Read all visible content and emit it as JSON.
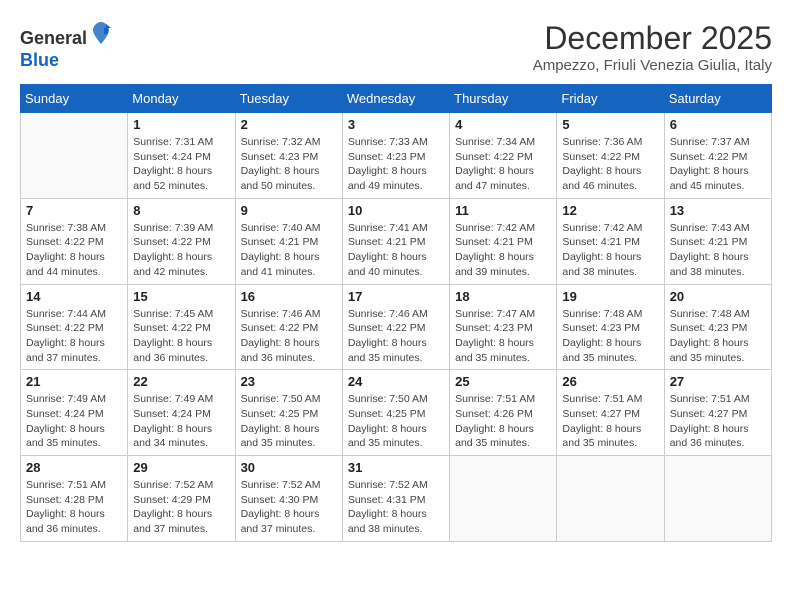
{
  "logo": {
    "general": "General",
    "blue": "Blue"
  },
  "title": "December 2025",
  "subtitle": "Ampezzo, Friuli Venezia Giulia, Italy",
  "days_of_week": [
    "Sunday",
    "Monday",
    "Tuesday",
    "Wednesday",
    "Thursday",
    "Friday",
    "Saturday"
  ],
  "weeks": [
    [
      {
        "day": "",
        "sunrise": "",
        "sunset": "",
        "daylight": ""
      },
      {
        "day": "1",
        "sunrise": "Sunrise: 7:31 AM",
        "sunset": "Sunset: 4:24 PM",
        "daylight": "Daylight: 8 hours and 52 minutes."
      },
      {
        "day": "2",
        "sunrise": "Sunrise: 7:32 AM",
        "sunset": "Sunset: 4:23 PM",
        "daylight": "Daylight: 8 hours and 50 minutes."
      },
      {
        "day": "3",
        "sunrise": "Sunrise: 7:33 AM",
        "sunset": "Sunset: 4:23 PM",
        "daylight": "Daylight: 8 hours and 49 minutes."
      },
      {
        "day": "4",
        "sunrise": "Sunrise: 7:34 AM",
        "sunset": "Sunset: 4:22 PM",
        "daylight": "Daylight: 8 hours and 47 minutes."
      },
      {
        "day": "5",
        "sunrise": "Sunrise: 7:36 AM",
        "sunset": "Sunset: 4:22 PM",
        "daylight": "Daylight: 8 hours and 46 minutes."
      },
      {
        "day": "6",
        "sunrise": "Sunrise: 7:37 AM",
        "sunset": "Sunset: 4:22 PM",
        "daylight": "Daylight: 8 hours and 45 minutes."
      }
    ],
    [
      {
        "day": "7",
        "sunrise": "Sunrise: 7:38 AM",
        "sunset": "Sunset: 4:22 PM",
        "daylight": "Daylight: 8 hours and 44 minutes."
      },
      {
        "day": "8",
        "sunrise": "Sunrise: 7:39 AM",
        "sunset": "Sunset: 4:22 PM",
        "daylight": "Daylight: 8 hours and 42 minutes."
      },
      {
        "day": "9",
        "sunrise": "Sunrise: 7:40 AM",
        "sunset": "Sunset: 4:21 PM",
        "daylight": "Daylight: 8 hours and 41 minutes."
      },
      {
        "day": "10",
        "sunrise": "Sunrise: 7:41 AM",
        "sunset": "Sunset: 4:21 PM",
        "daylight": "Daylight: 8 hours and 40 minutes."
      },
      {
        "day": "11",
        "sunrise": "Sunrise: 7:42 AM",
        "sunset": "Sunset: 4:21 PM",
        "daylight": "Daylight: 8 hours and 39 minutes."
      },
      {
        "day": "12",
        "sunrise": "Sunrise: 7:42 AM",
        "sunset": "Sunset: 4:21 PM",
        "daylight": "Daylight: 8 hours and 38 minutes."
      },
      {
        "day": "13",
        "sunrise": "Sunrise: 7:43 AM",
        "sunset": "Sunset: 4:21 PM",
        "daylight": "Daylight: 8 hours and 38 minutes."
      }
    ],
    [
      {
        "day": "14",
        "sunrise": "Sunrise: 7:44 AM",
        "sunset": "Sunset: 4:22 PM",
        "daylight": "Daylight: 8 hours and 37 minutes."
      },
      {
        "day": "15",
        "sunrise": "Sunrise: 7:45 AM",
        "sunset": "Sunset: 4:22 PM",
        "daylight": "Daylight: 8 hours and 36 minutes."
      },
      {
        "day": "16",
        "sunrise": "Sunrise: 7:46 AM",
        "sunset": "Sunset: 4:22 PM",
        "daylight": "Daylight: 8 hours and 36 minutes."
      },
      {
        "day": "17",
        "sunrise": "Sunrise: 7:46 AM",
        "sunset": "Sunset: 4:22 PM",
        "daylight": "Daylight: 8 hours and 35 minutes."
      },
      {
        "day": "18",
        "sunrise": "Sunrise: 7:47 AM",
        "sunset": "Sunset: 4:23 PM",
        "daylight": "Daylight: 8 hours and 35 minutes."
      },
      {
        "day": "19",
        "sunrise": "Sunrise: 7:48 AM",
        "sunset": "Sunset: 4:23 PM",
        "daylight": "Daylight: 8 hours and 35 minutes."
      },
      {
        "day": "20",
        "sunrise": "Sunrise: 7:48 AM",
        "sunset": "Sunset: 4:23 PM",
        "daylight": "Daylight: 8 hours and 35 minutes."
      }
    ],
    [
      {
        "day": "21",
        "sunrise": "Sunrise: 7:49 AM",
        "sunset": "Sunset: 4:24 PM",
        "daylight": "Daylight: 8 hours and 35 minutes."
      },
      {
        "day": "22",
        "sunrise": "Sunrise: 7:49 AM",
        "sunset": "Sunset: 4:24 PM",
        "daylight": "Daylight: 8 hours and 34 minutes."
      },
      {
        "day": "23",
        "sunrise": "Sunrise: 7:50 AM",
        "sunset": "Sunset: 4:25 PM",
        "daylight": "Daylight: 8 hours and 35 minutes."
      },
      {
        "day": "24",
        "sunrise": "Sunrise: 7:50 AM",
        "sunset": "Sunset: 4:25 PM",
        "daylight": "Daylight: 8 hours and 35 minutes."
      },
      {
        "day": "25",
        "sunrise": "Sunrise: 7:51 AM",
        "sunset": "Sunset: 4:26 PM",
        "daylight": "Daylight: 8 hours and 35 minutes."
      },
      {
        "day": "26",
        "sunrise": "Sunrise: 7:51 AM",
        "sunset": "Sunset: 4:27 PM",
        "daylight": "Daylight: 8 hours and 35 minutes."
      },
      {
        "day": "27",
        "sunrise": "Sunrise: 7:51 AM",
        "sunset": "Sunset: 4:27 PM",
        "daylight": "Daylight: 8 hours and 36 minutes."
      }
    ],
    [
      {
        "day": "28",
        "sunrise": "Sunrise: 7:51 AM",
        "sunset": "Sunset: 4:28 PM",
        "daylight": "Daylight: 8 hours and 36 minutes."
      },
      {
        "day": "29",
        "sunrise": "Sunrise: 7:52 AM",
        "sunset": "Sunset: 4:29 PM",
        "daylight": "Daylight: 8 hours and 37 minutes."
      },
      {
        "day": "30",
        "sunrise": "Sunrise: 7:52 AM",
        "sunset": "Sunset: 4:30 PM",
        "daylight": "Daylight: 8 hours and 37 minutes."
      },
      {
        "day": "31",
        "sunrise": "Sunrise: 7:52 AM",
        "sunset": "Sunset: 4:31 PM",
        "daylight": "Daylight: 8 hours and 38 minutes."
      },
      {
        "day": "",
        "sunrise": "",
        "sunset": "",
        "daylight": ""
      },
      {
        "day": "",
        "sunrise": "",
        "sunset": "",
        "daylight": ""
      },
      {
        "day": "",
        "sunrise": "",
        "sunset": "",
        "daylight": ""
      }
    ]
  ]
}
